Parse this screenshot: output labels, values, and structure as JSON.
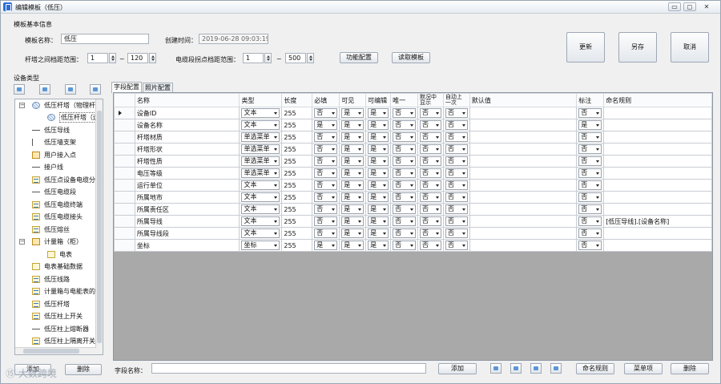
{
  "window": {
    "title": "编辑模板（低压）",
    "buttons": [
      "▭",
      "◻",
      "✕"
    ]
  },
  "basic_info": {
    "section_title": "模板基本信息",
    "template_name_label": "模板名称：",
    "template_name_value": "低压",
    "created_time_label": "创建时间：",
    "created_time_value": "2019-06-28 09:03:19",
    "pole_range_label": "杆塔之间档距范围：",
    "pole_range_min": "1",
    "pole_range_max": "120",
    "cable_range_label": "电缆段拐点档距范围：",
    "cable_range_min": "1",
    "cable_range_max": "500",
    "range_separator": "~",
    "function_config_button": "功能配置",
    "read_template_button": "读取模板"
  },
  "actions": {
    "update": "更新",
    "save_as": "另存",
    "cancel": "取消"
  },
  "device_types": {
    "title": "设备类型",
    "items": [
      {
        "label": "低压杆塔（物理杆",
        "icon": "pole-icon",
        "expander": "−"
      },
      {
        "label": "低压杆塔（运",
        "icon": "pole-icon",
        "expander": ""
      },
      {
        "label": "低压导线",
        "icon": "line-icon",
        "expander": ""
      },
      {
        "label": "低压墙支架",
        "icon": "bracket-icon",
        "expander": ""
      },
      {
        "label": "用户接入点",
        "icon": "access-point-icon",
        "expander": ""
      },
      {
        "label": "接户线",
        "icon": "line-icon",
        "expander": ""
      },
      {
        "label": "低压点设备电缆分",
        "icon": "document-icon",
        "expander": ""
      },
      {
        "label": "低压电缆段",
        "icon": "line-icon",
        "expander": ""
      },
      {
        "label": "低压电缆终端",
        "icon": "document-icon",
        "expander": ""
      },
      {
        "label": "低压电缆接头",
        "icon": "document-icon",
        "expander": ""
      },
      {
        "label": "低压熔丝",
        "icon": "document-icon",
        "expander": ""
      },
      {
        "label": "计量箱（柜）",
        "icon": "box-icon",
        "expander": "−"
      },
      {
        "label": "电表",
        "icon": "meter-icon",
        "expander": ""
      },
      {
        "label": "电表基础数据",
        "icon": "meter-icon",
        "expander": ""
      },
      {
        "label": "低压线路",
        "icon": "document-icon",
        "expander": ""
      },
      {
        "label": "计量箱与电能表的",
        "icon": "document-icon",
        "expander": ""
      },
      {
        "label": "低压杆塔",
        "icon": "document-icon",
        "expander": ""
      },
      {
        "label": "低压柱上开关",
        "icon": "document-icon",
        "expander": ""
      },
      {
        "label": "低压柱上熔断器",
        "icon": "line-icon",
        "expander": ""
      },
      {
        "label": "低压柱上隔离开关",
        "icon": "document-icon",
        "expander": ""
      }
    ],
    "add_button": "添加",
    "delete_button": "删除"
  },
  "tabs": [
    "字段配置",
    "照片配置"
  ],
  "grid": {
    "headers": [
      "名称",
      "类型",
      "长度",
      "必填",
      "可见",
      "可编辑",
      "唯一",
      "默况中显示",
      "自动上一次",
      "默认值",
      "标注",
      "命名规则"
    ],
    "rows": [
      {
        "name": "设备ID",
        "type": "文本",
        "length": "255",
        "required": "否",
        "visible": "是",
        "editable": "是",
        "unique": "否",
        "show": "否",
        "auto": "否",
        "default": "",
        "label": "否",
        "rule": ""
      },
      {
        "name": "设备名称",
        "type": "文本",
        "length": "255",
        "required": "是",
        "visible": "是",
        "editable": "是",
        "unique": "否",
        "show": "否",
        "auto": "否",
        "default": "",
        "label": "是",
        "rule": ""
      },
      {
        "name": "杆塔材质",
        "type": "单选菜单",
        "length": "255",
        "required": "否",
        "visible": "是",
        "editable": "是",
        "unique": "否",
        "show": "否",
        "auto": "否",
        "default": "",
        "label": "否",
        "rule": ""
      },
      {
        "name": "杆塔形状",
        "type": "单选菜单",
        "length": "255",
        "required": "否",
        "visible": "是",
        "editable": "是",
        "unique": "否",
        "show": "否",
        "auto": "否",
        "default": "",
        "label": "否",
        "rule": ""
      },
      {
        "name": "杆塔性质",
        "type": "单选菜单",
        "length": "255",
        "required": "否",
        "visible": "是",
        "editable": "是",
        "unique": "否",
        "show": "否",
        "auto": "否",
        "default": "",
        "label": "否",
        "rule": ""
      },
      {
        "name": "电压等级",
        "type": "单选菜单",
        "length": "255",
        "required": "否",
        "visible": "是",
        "editable": "是",
        "unique": "否",
        "show": "否",
        "auto": "否",
        "default": "",
        "label": "否",
        "rule": ""
      },
      {
        "name": "运行单位",
        "type": "文本",
        "length": "255",
        "required": "否",
        "visible": "是",
        "editable": "是",
        "unique": "否",
        "show": "否",
        "auto": "否",
        "default": "",
        "label": "否",
        "rule": ""
      },
      {
        "name": "所属地市",
        "type": "文本",
        "length": "255",
        "required": "否",
        "visible": "是",
        "editable": "是",
        "unique": "否",
        "show": "否",
        "auto": "否",
        "default": "",
        "label": "否",
        "rule": ""
      },
      {
        "name": "所属责任区",
        "type": "文本",
        "length": "255",
        "required": "否",
        "visible": "是",
        "editable": "是",
        "unique": "否",
        "show": "否",
        "auto": "否",
        "default": "",
        "label": "否",
        "rule": ""
      },
      {
        "name": "所属导线",
        "type": "文本",
        "length": "255",
        "required": "否",
        "visible": "是",
        "editable": "是",
        "unique": "否",
        "show": "否",
        "auto": "否",
        "default": "",
        "label": "否",
        "rule": "[低压导线].[设备名称]"
      },
      {
        "name": "所属导线段",
        "type": "文本",
        "length": "255",
        "required": "否",
        "visible": "是",
        "editable": "是",
        "unique": "否",
        "show": "否",
        "auto": "否",
        "default": "",
        "label": "否",
        "rule": ""
      },
      {
        "name": "坐标",
        "type": "坐标",
        "length": "255",
        "required": "是",
        "visible": "是",
        "editable": "是",
        "unique": "否",
        "show": "否",
        "auto": "否",
        "default": "",
        "label": "否",
        "rule": ""
      }
    ]
  },
  "footer": {
    "field_name_label": "字段名称：",
    "field_name_value": "",
    "add_button": "添加",
    "naming_rule_button": "命名规则",
    "menu_item_button": "菜单项",
    "delete_button": "删除"
  },
  "watermark": "⑮ 大数跨境"
}
